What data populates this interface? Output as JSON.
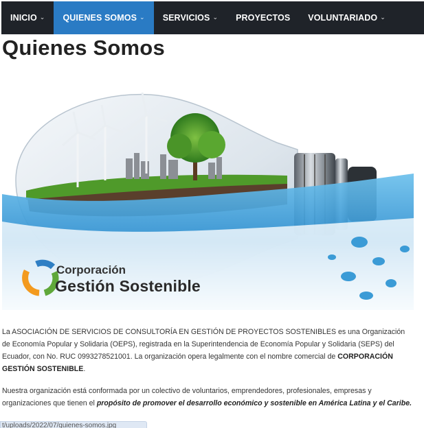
{
  "nav": {
    "items": [
      {
        "label": "INICIO",
        "dropdown": true,
        "active": false
      },
      {
        "label": "QUIENES SOMOS",
        "dropdown": true,
        "active": true
      },
      {
        "label": "SERVICIOS",
        "dropdown": true,
        "active": false
      },
      {
        "label": "PROYECTOS",
        "dropdown": false,
        "active": false
      },
      {
        "label": "VOLUNTARIADO",
        "dropdown": true,
        "active": false
      }
    ]
  },
  "page": {
    "title": "Quienes Somos"
  },
  "hero": {
    "logo_line1": "Corporación",
    "logo_line2": "Gestión Sostenible"
  },
  "content": {
    "p1_a": "La ASOCIACIÓN DE SERVICIOS DE CONSULTORÍA EN GESTIÓN DE PROYECTOS SOSTENIBLES es una Organización de Economía Popular y Solidaria (OEPS), registrada en la Superintendencia de Economía Popular y Solidaria (SEPS) del Ecuador, con No. RUC 0993278521001. La organización opera legalmente con el nombre comercial de ",
    "p1_b": "CORPORACIÓN GESTIÓN SOSTENIBLE",
    "p1_c": ".",
    "p2_a": "Nuestra organización está conformada por un colectivo de voluntarios, emprendedores, profesionales, empresas y organizaciones que tienen el ",
    "p2_b": "propósito de promover el desarrollo económico y sostenible en América Latina y el Caribe."
  },
  "status_url": "t/uploads/2022/07/quienes-somos.jpg",
  "colors": {
    "nav_bg": "#1f2329",
    "nav_active": "#2a7bc4",
    "water": "#3b9bd6",
    "grass": "#4f9a2a"
  }
}
